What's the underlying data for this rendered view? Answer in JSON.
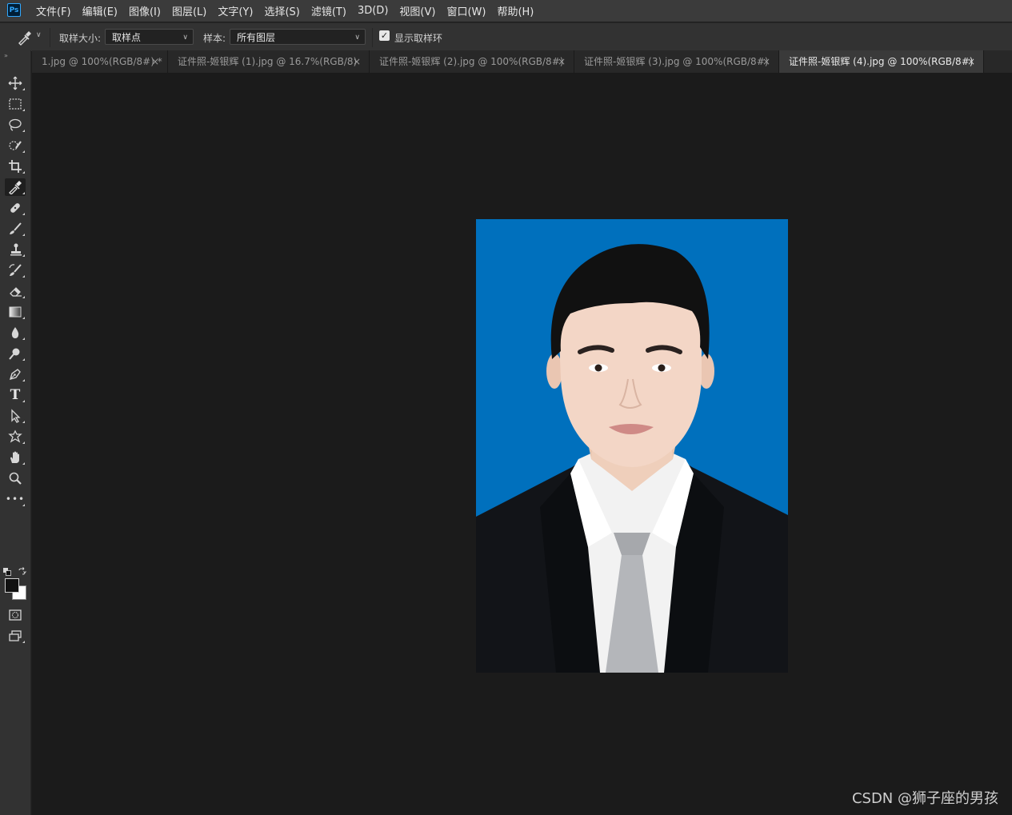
{
  "app": {
    "logo": "Ps"
  },
  "menu": [
    "文件(F)",
    "编辑(E)",
    "图像(I)",
    "图层(L)",
    "文字(Y)",
    "选择(S)",
    "滤镜(T)",
    "3D(D)",
    "视图(V)",
    "窗口(W)",
    "帮助(H)"
  ],
  "options": {
    "sample_size_label": "取样大小:",
    "sample_size_value": "取样点",
    "sample_label": "样本:",
    "sample_value": "所有图层",
    "show_ring_label": "显示取样环",
    "show_ring_checked": true
  },
  "tabs": [
    {
      "label": "1.jpg @ 100%(RGB/8#) *",
      "close": "×",
      "active": false
    },
    {
      "label": "证件照-姬银辉 (1).jpg @ 16.7%(RGB/8)",
      "close": "×",
      "active": false
    },
    {
      "label": "证件照-姬银辉 (2).jpg @ 100%(RGB/8#)",
      "close": "×",
      "active": false
    },
    {
      "label": "证件照-姬银辉 (3).jpg @ 100%(RGB/8#)",
      "close": "×",
      "active": false
    },
    {
      "label": "证件照-姬银辉 (4).jpg @ 100%(RGB/8#)",
      "close": "×",
      "active": true
    }
  ],
  "toolbar": {
    "grip": "»",
    "tools": [
      "move-tool",
      "marquee-tool",
      "lasso-tool",
      "quick-selection-tool",
      "crop-tool",
      "eyedropper-tool",
      "healing-brush-tool",
      "brush-tool",
      "clone-stamp-tool",
      "history-brush-tool",
      "eraser-tool",
      "gradient-tool",
      "blur-tool",
      "dodge-tool",
      "pen-tool",
      "type-tool",
      "path-selection-tool",
      "custom-shape-tool",
      "hand-tool",
      "zoom-tool",
      "more-tools"
    ],
    "selected": "eyedropper-tool",
    "type_glyph": "T",
    "more_glyph": "•••",
    "colors": {
      "foreground": "#111111",
      "background": "#ffffff"
    }
  },
  "canvas": {
    "background_color": "#0070bd"
  },
  "watermark": "CSDN @狮子座的男孩"
}
